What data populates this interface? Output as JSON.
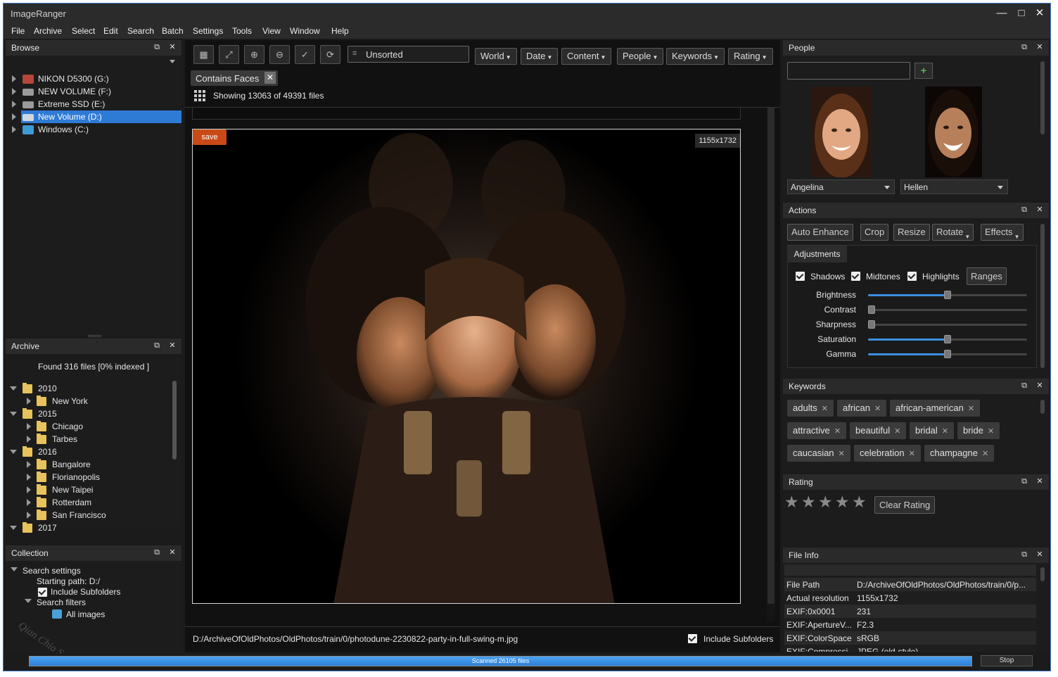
{
  "app": {
    "title": "ImageRanger"
  },
  "menu": [
    "File",
    "Archive",
    "Select",
    "Edit",
    "Search",
    "Batch",
    "Settings",
    "Tools",
    "View",
    "Window",
    "Help"
  ],
  "browse": {
    "title": "Browse",
    "drives": [
      "NIKON D5300 (G:)",
      "NEW VOLUME (F:)",
      "Extreme SSD (E:)",
      "New Volume (D:)",
      "Windows (C:)"
    ],
    "selected": "New Volume (D:)"
  },
  "archive": {
    "title": "Archive",
    "status": "Found 316 files [0% indexed ]",
    "tree": [
      {
        "label": "2010",
        "level": 0
      },
      {
        "label": "New York",
        "level": 1
      },
      {
        "label": "2015",
        "level": 0
      },
      {
        "label": "Chicago",
        "level": 1
      },
      {
        "label": "Tarbes",
        "level": 1
      },
      {
        "label": "2016",
        "level": 0
      },
      {
        "label": "Bangalore",
        "level": 1
      },
      {
        "label": "Florianopolis",
        "level": 1
      },
      {
        "label": "New Taipei",
        "level": 1
      },
      {
        "label": "Rotterdam",
        "level": 1
      },
      {
        "label": "San Francisco",
        "level": 1
      },
      {
        "label": "2017",
        "level": 0
      }
    ]
  },
  "collection": {
    "title": "Collection",
    "search_settings": "Search settings",
    "starting_path": "Starting path: D:/",
    "include_subfolders": "Include Subfolders",
    "search_filters": "Search filters",
    "all_images": "All images",
    "watermark": "Qian Chia Soft"
  },
  "toolbar": {
    "sort": "Unsorted",
    "filters": [
      "World",
      "Date",
      "Content",
      "People",
      "Keywords",
      "Rating"
    ]
  },
  "filter_tag": "Contains Faces",
  "showing": "Showing 13063 of 49391 files",
  "viewer": {
    "save_label": "save",
    "resolution": "1155x1732",
    "path": "D:/ArchiveOfOldPhotos/OldPhotos/train/0/photodune-2230822-party-in-full-swing-m.jpg",
    "include_subfolders": "Include Subfolders"
  },
  "people": {
    "title": "People",
    "search_value": "",
    "persons": [
      "Angelina",
      "Hellen"
    ]
  },
  "actions": {
    "title": "Actions",
    "buttons": [
      "Auto Enhance",
      "Crop",
      "Resize",
      "Rotate",
      "Effects"
    ],
    "adjustments_tab": "Adjustments",
    "checks": [
      "Shadows",
      "Midtones",
      "Highlights"
    ],
    "ranges": "Ranges",
    "sliders": [
      {
        "label": "Brightness",
        "value": 0.5
      },
      {
        "label": "Contrast",
        "value": 0
      },
      {
        "label": "Sharpness",
        "value": 0
      },
      {
        "label": "Saturation",
        "value": 0.5
      },
      {
        "label": "Gamma",
        "value": 0.5
      }
    ]
  },
  "keywords": {
    "title": "Keywords",
    "items": [
      "adults",
      "african",
      "african-american",
      "attractive",
      "beautiful",
      "bridal",
      "bride",
      "caucasian",
      "celebration",
      "champagne"
    ]
  },
  "rating": {
    "title": "Rating",
    "stars": 5,
    "clear": "Clear Rating"
  },
  "fileinfo": {
    "title": "File Info",
    "rows": [
      {
        "k": "File Path",
        "v": "D:/ArchiveOfOldPhotos/OldPhotos/train/0/p..."
      },
      {
        "k": "Actual resolution",
        "v": "1155x1732"
      },
      {
        "k": "EXIF:0x0001",
        "v": "231"
      },
      {
        "k": "EXIF:ApertureV...",
        "v": "F2.3"
      },
      {
        "k": "EXIF:ColorSpace",
        "v": "sRGB"
      },
      {
        "k": "EXIF:Compressi...",
        "v": "JPEG (old-style)"
      }
    ]
  },
  "statusbar": {
    "progress_text": "Scanned 26105 files",
    "progress": 1.0,
    "stop": "Stop"
  },
  "colors": {
    "accent": "#3d8fe0",
    "save": "#c94a16",
    "selection": "#2e7bd6"
  }
}
